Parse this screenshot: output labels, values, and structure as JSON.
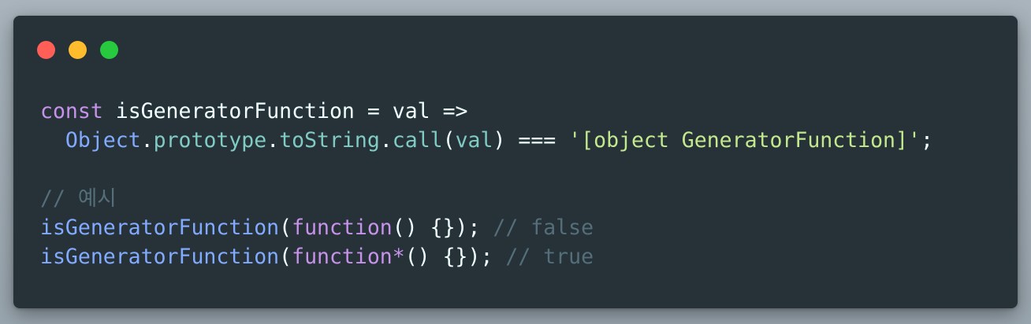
{
  "window": {
    "traffic_lights": {
      "close_color": "#ff5f56",
      "minimize_color": "#ffbd2e",
      "maximize_color": "#27c93f"
    }
  },
  "code": {
    "language": "javascript",
    "lines": [
      [
        {
          "text": "const",
          "type": "keyword"
        },
        {
          "text": " isGeneratorFunction ",
          "type": "plain"
        },
        {
          "text": "=",
          "type": "plain"
        },
        {
          "text": " val ",
          "type": "plain"
        },
        {
          "text": "=>",
          "type": "plain"
        }
      ],
      [
        {
          "text": "  ",
          "type": "plain"
        },
        {
          "text": "Object",
          "type": "function"
        },
        {
          "text": ".",
          "type": "plain"
        },
        {
          "text": "prototype",
          "type": "property"
        },
        {
          "text": ".",
          "type": "plain"
        },
        {
          "text": "toString",
          "type": "property"
        },
        {
          "text": ".",
          "type": "plain"
        },
        {
          "text": "call",
          "type": "property"
        },
        {
          "text": "(",
          "type": "plain"
        },
        {
          "text": "val",
          "type": "property"
        },
        {
          "text": ") === ",
          "type": "plain"
        },
        {
          "text": "'[object GeneratorFunction]'",
          "type": "string"
        },
        {
          "text": ";",
          "type": "plain"
        }
      ],
      [],
      [
        {
          "text": "// 예시",
          "type": "comment"
        }
      ],
      [
        {
          "text": "isGeneratorFunction",
          "type": "function"
        },
        {
          "text": "(",
          "type": "plain"
        },
        {
          "text": "function",
          "type": "keyword"
        },
        {
          "text": "() {}); ",
          "type": "plain"
        },
        {
          "text": "// false",
          "type": "comment"
        }
      ],
      [
        {
          "text": "isGeneratorFunction",
          "type": "function"
        },
        {
          "text": "(",
          "type": "plain"
        },
        {
          "text": "function",
          "type": "keyword"
        },
        {
          "text": "*",
          "type": "keyword"
        },
        {
          "text": "() {}); ",
          "type": "plain"
        },
        {
          "text": "// true",
          "type": "comment"
        }
      ]
    ]
  }
}
